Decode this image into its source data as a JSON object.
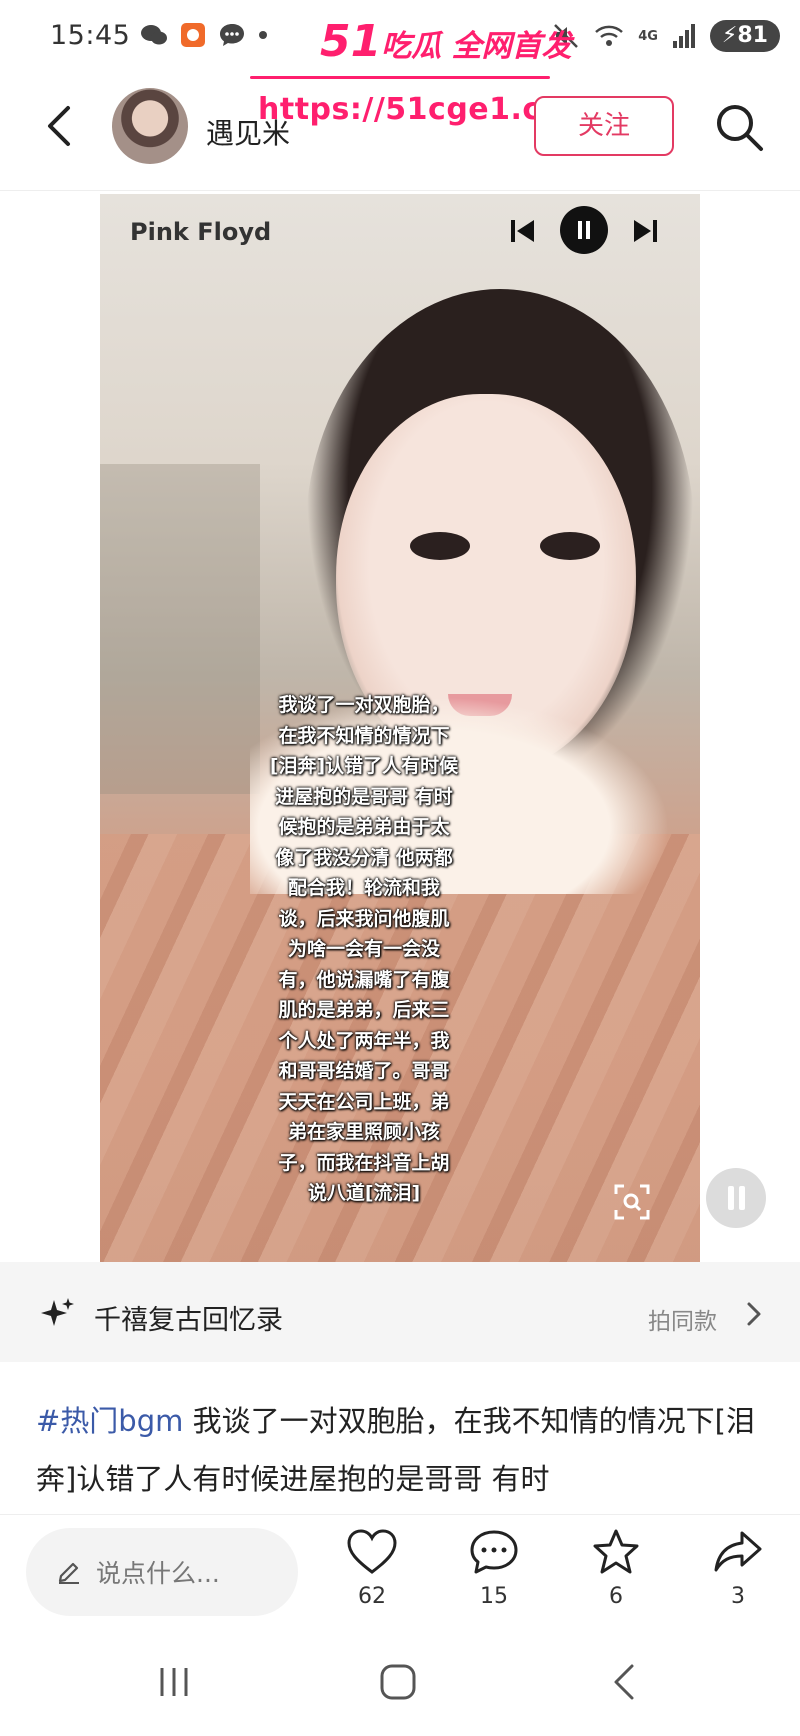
{
  "status_bar": {
    "time": "15:45",
    "network": "4G",
    "battery": "81"
  },
  "watermark": {
    "title_num": "51",
    "title_text": "吃瓜 全网首发",
    "url": "https://51cge1.com"
  },
  "header": {
    "username": "遇见米",
    "follow_label": "关注"
  },
  "media": {
    "music_label": "Pink Floyd",
    "caption_overlay": "我谈了一对双胞胎，\n在我不知情的情况下\n[泪奔]认错了人有时候\n进屋抱的是哥哥 有时\n候抱的是弟弟由于太\n像了我没分清 他两都\n配合我！轮流和我\n谈，后来我问他腹肌\n为啥一会有一会没\n有，他说漏嘴了有腹\n肌的是弟弟，后来三\n个人处了两年半，我\n和哥哥结婚了。哥哥\n天天在公司上班，弟\n弟在家里照顾小孩\n子，而我在抖音上胡\n说八道[流泪]"
  },
  "music_row": {
    "title": "千禧复古回忆录",
    "same_style_label": "拍同款"
  },
  "description": {
    "tag": "#热门bgm",
    "text": " 我谈了一对双胞胎，在我不知情的情况下[泪奔]认错了人有时候进屋抱的是哥哥 有时"
  },
  "actions": {
    "comment_placeholder": "说点什么...",
    "likes": "62",
    "comments": "15",
    "favorites": "6",
    "shares": "3"
  },
  "colors": {
    "accent": "#e33a63",
    "watermark": "#ff1f6e",
    "hashtag": "#3b5aa8"
  }
}
